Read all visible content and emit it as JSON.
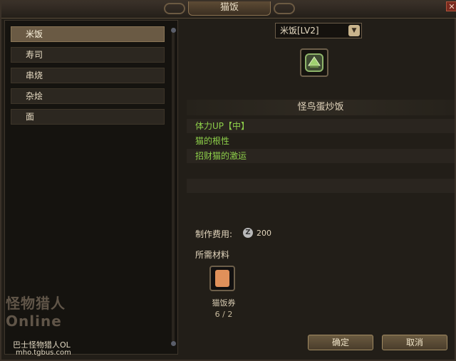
{
  "window": {
    "title": "猫饭",
    "close_symbol": "✕"
  },
  "categories": [
    {
      "label": "米饭",
      "selected": true
    },
    {
      "label": "寿司",
      "selected": false
    },
    {
      "label": "串烧",
      "selected": false
    },
    {
      "label": "杂烩",
      "selected": false
    },
    {
      "label": "面",
      "selected": false
    }
  ],
  "recipe": {
    "level_select": "米饭[LV2]",
    "dropdown_icon": "chevron-down-icon",
    "food_icon": "food-dish-icon",
    "name": "怪鸟蛋炒饭",
    "effects": [
      "体力UP【中】",
      "猫的根性",
      "招财猫的激运"
    ]
  },
  "cost": {
    "label": "制作费用:",
    "coin_icon": "zenny-coin-icon",
    "coin_glyph": "Z",
    "value": "200"
  },
  "materials": {
    "label": "所需材料",
    "items": [
      {
        "name": "猫饭券",
        "count": "6 / 2",
        "icon": "meal-ticket-icon"
      }
    ]
  },
  "buttons": {
    "confirm": "确定",
    "cancel": "取消"
  },
  "watermark": {
    "title": "怪物猎人Online",
    "sub": "巴士怪物猎人OL",
    "url": "mho.tgbus.com"
  },
  "colors": {
    "effect_green": "#8ed04a",
    "selected_item": "#6a5a44",
    "button": "#5a4b35"
  }
}
